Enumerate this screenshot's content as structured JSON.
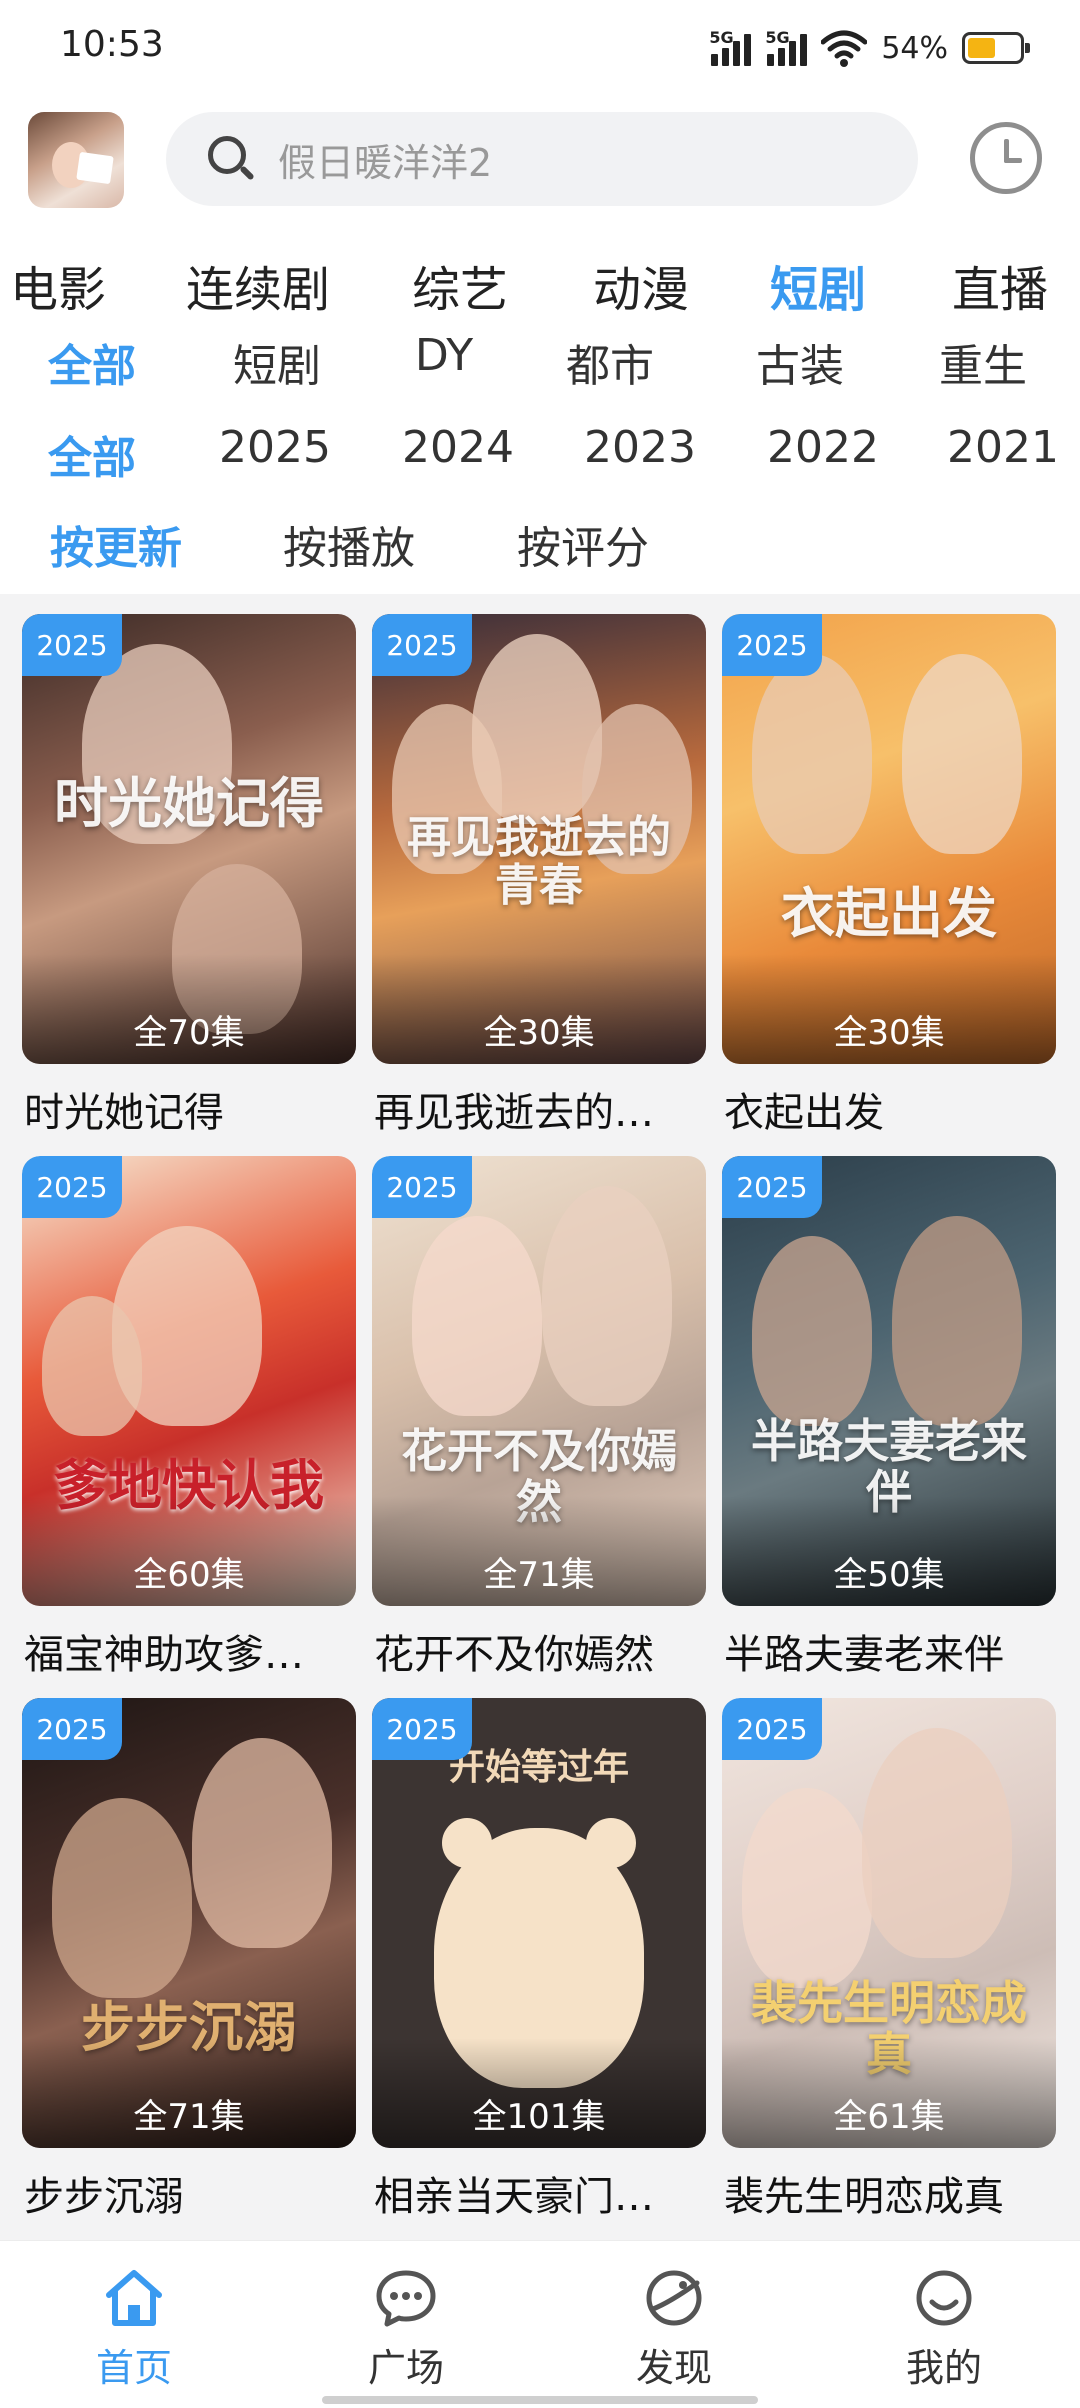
{
  "status_bar": {
    "time": "10:53",
    "battery": "54%",
    "battery_level": 0.54,
    "network_1": "5G",
    "network_2": "5G"
  },
  "header": {
    "search_placeholder": "假日暖洋洋2"
  },
  "categories": [
    "电影",
    "连续剧",
    "综艺",
    "动漫",
    "短剧",
    "直播"
  ],
  "active_category": "短剧",
  "filters": {
    "genre": [
      "全部",
      "短剧",
      "DY",
      "都市",
      "古装",
      "重生"
    ],
    "year": [
      "全部",
      "2025",
      "2024",
      "2023",
      "2022",
      "2021"
    ],
    "sort": [
      "按更新",
      "按播放",
      "按评分"
    ]
  },
  "colors": {
    "accent": "#3a9af0",
    "battery": "#f5b412"
  },
  "items": [
    {
      "title": "时光她记得",
      "year": "2025",
      "episodes": "全70集",
      "poster_text": "时光她记得"
    },
    {
      "title": "再见我逝去的…",
      "year": "2025",
      "episodes": "全30集",
      "poster_text": "再见我逝去的青春"
    },
    {
      "title": "衣起出发",
      "year": "2025",
      "episodes": "全30集",
      "poster_text": "衣起出发"
    },
    {
      "title": "福宝神助攻爹…",
      "year": "2025",
      "episodes": "全60集",
      "poster_text": "爹地快认我"
    },
    {
      "title": "花开不及你嫣然",
      "year": "2025",
      "episodes": "全71集",
      "poster_text": "花开不及你嫣然"
    },
    {
      "title": "半路夫妻老来伴",
      "year": "2025",
      "episodes": "全50集",
      "poster_text": "半路夫妻老来伴"
    },
    {
      "title": "步步沉溺",
      "year": "2025",
      "episodes": "全71集",
      "poster_text": "步步沉溺"
    },
    {
      "title": "相亲当天豪门…",
      "year": "2025",
      "episodes": "全101集",
      "poster_text": "开始等过年"
    },
    {
      "title": "裴先生明恋成真",
      "year": "2025",
      "episodes": "全61集",
      "poster_text": "裴先生明恋成真"
    }
  ],
  "bottom_nav": [
    "首页",
    "广场",
    "发现",
    "我的"
  ]
}
